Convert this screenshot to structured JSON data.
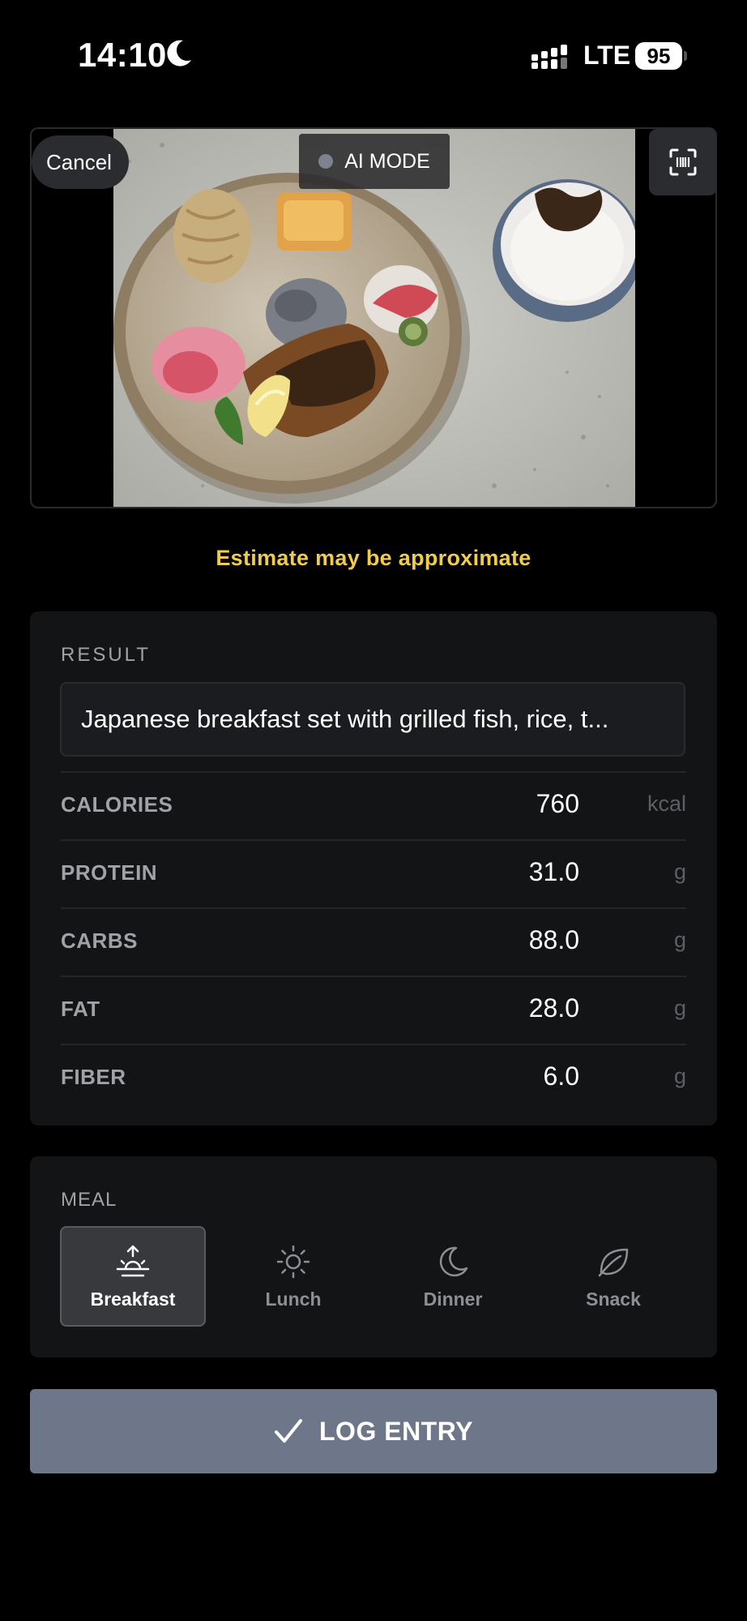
{
  "status_bar": {
    "time": "14:10",
    "network": "LTE",
    "battery": "95"
  },
  "camera": {
    "cancel_label": "Cancel",
    "mode_label": "AI MODE",
    "photo_icon": "food-photo",
    "scan_icon": "barcode-scan-icon"
  },
  "notice": "Estimate may be approximate",
  "result": {
    "section_label": "RESULT",
    "description": "Japanese breakfast set with grilled fish, rice, t...",
    "rows": [
      {
        "label": "CALORIES",
        "value": "760",
        "unit": "kcal"
      },
      {
        "label": "PROTEIN",
        "value": "31.0",
        "unit": "g"
      },
      {
        "label": "CARBS",
        "value": "88.0",
        "unit": "g"
      },
      {
        "label": "FAT",
        "value": "28.0",
        "unit": "g"
      },
      {
        "label": "FIBER",
        "value": "6.0",
        "unit": "g"
      }
    ]
  },
  "meal": {
    "section_label": "MEAL",
    "options": [
      {
        "label": "Breakfast",
        "icon": "sunrise-icon",
        "selected": true
      },
      {
        "label": "Lunch",
        "icon": "sun-icon",
        "selected": false
      },
      {
        "label": "Dinner",
        "icon": "moon-icon",
        "selected": false
      },
      {
        "label": "Snack",
        "icon": "leaf-icon",
        "selected": false
      }
    ]
  },
  "log_button": {
    "label": "LOG ENTRY",
    "icon": "checkmark-icon"
  },
  "colors": {
    "accent_warning": "#f0cc4a",
    "button_bg": "#6e7789",
    "card_bg": "#131416"
  }
}
